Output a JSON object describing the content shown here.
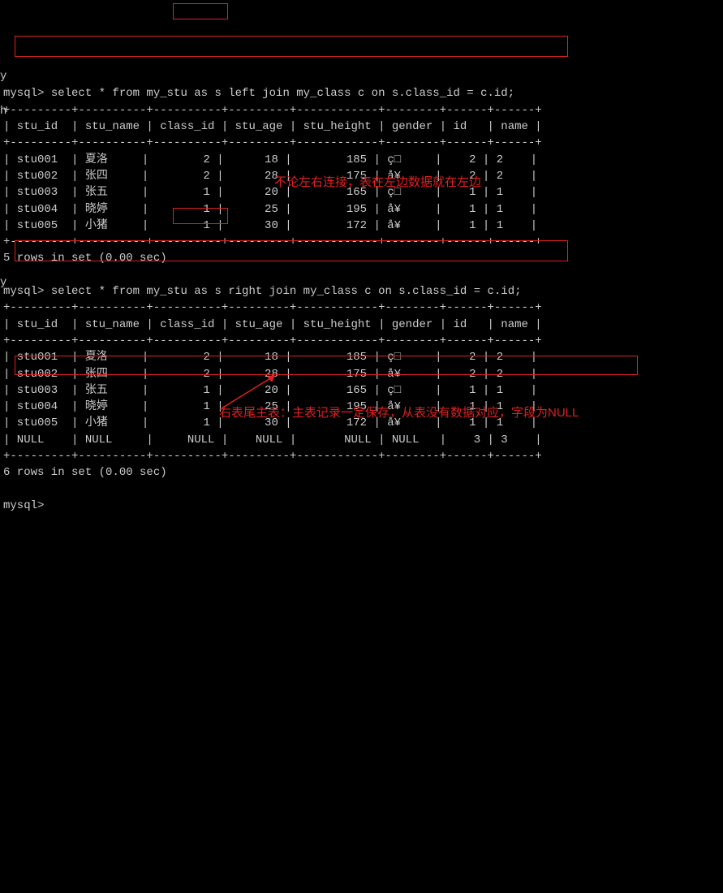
{
  "query1": {
    "prompt": "mysql> ",
    "sql": "select * from my_stu as s left join my_class c on s.class_id = c.id;",
    "border": "+---------+----------+----------+---------+------------+--------+------+------+",
    "header": "| stu_id  | stu_name | class_id | stu_age | stu_height | gender | id   | name |",
    "rows": [
      "| stu001  | 夏洛     |        2 |      18 |        185 | ç□     |    2 | 2    |",
      "| stu002  | 张四     |        2 |      28 |        175 | å¥     |    2 | 2    |",
      "| stu003  | 张五     |        1 |      20 |        165 | ç□     |    1 | 1    |",
      "| stu004  | 晓婷     |        1 |      25 |        195 | å¥     |    1 | 1    |",
      "| stu005  | 小猪     |        1 |      30 |        172 | å¥     |    1 | 1    |"
    ],
    "result": "5 rows in set (0.00 sec)"
  },
  "query2": {
    "prompt": "mysql> ",
    "sql": "select * from my_stu as s right join my_class c on s.class_id = c.id;",
    "border": "+---------+----------+----------+---------+------------+--------+------+------+",
    "header": "| stu_id  | stu_name | class_id | stu_age | stu_height | gender | id   | name |",
    "rows": [
      "| stu001  | 夏洛     |        2 |      18 |        185 | ç□     |    2 | 2    |",
      "| stu002  | 张四     |        2 |      28 |        175 | å¥     |    2 | 2    |",
      "| stu003  | 张五     |        1 |      20 |        165 | ç□     |    1 | 1    |",
      "| stu004  | 晓婷     |        1 |      25 |        195 | å¥     |    1 | 1    |",
      "| stu005  | 小猪     |        1 |      30 |        172 | å¥     |    1 | 1    |",
      "| NULL    | NULL     |     NULL |    NULL |       NULL | NULL   |    3 | 3    |"
    ],
    "result": "6 rows in set (0.00 sec)"
  },
  "note1": "不论左右连接，表在左边数据就在左边",
  "note2": "右表尾主表：主表记录一定保存，从表没有数据对应，字段为NULL",
  "edge": {
    "y": "y",
    "h": "h",
    "y2": "y"
  },
  "final_prompt": "mysql> "
}
